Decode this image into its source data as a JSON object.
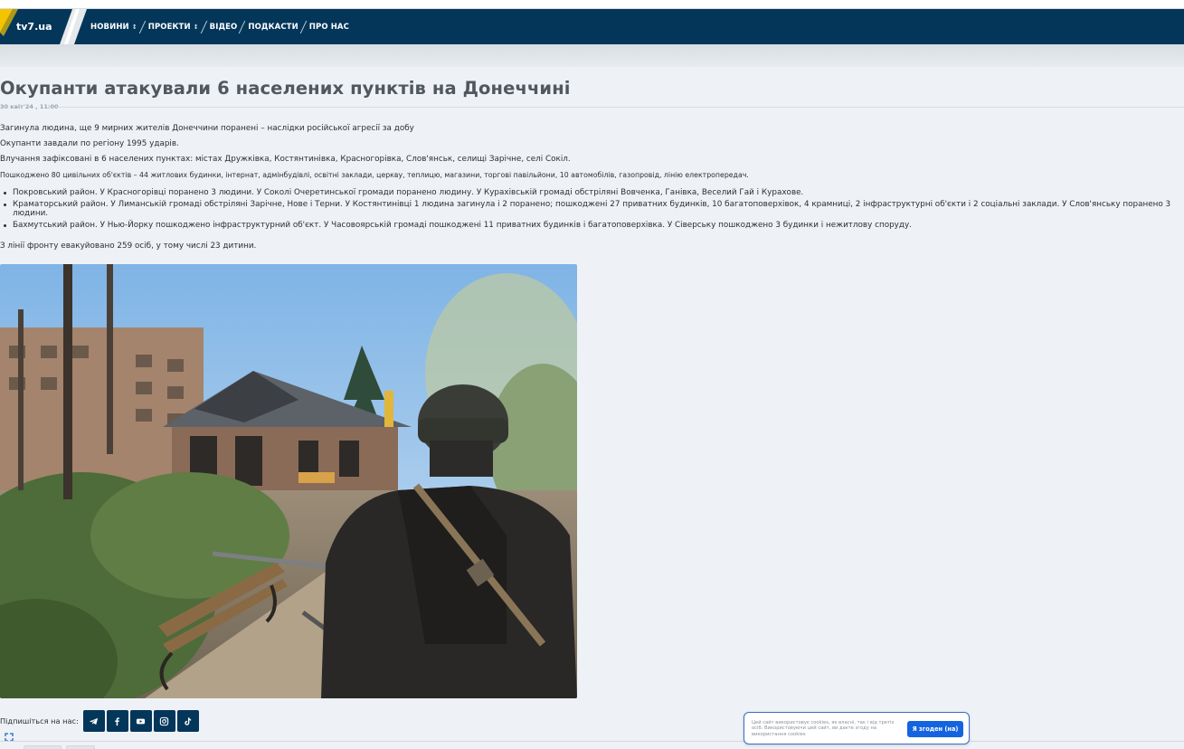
{
  "header": {
    "logo_text": "tv7.ua",
    "nav": [
      {
        "label": "НОВИНИ",
        "has_dropdown": true
      },
      {
        "label": "ПРОЕКТИ",
        "has_dropdown": true
      },
      {
        "label": "ВІДЕО",
        "has_dropdown": false
      },
      {
        "label": "ПОДКАСТИ",
        "has_dropdown": false
      },
      {
        "label": "ПРО НАС",
        "has_dropdown": false
      }
    ],
    "dropdown_icon": "caret-updown-icon",
    "colors": {
      "nav_bg": "#04365a",
      "logo_accent": "#f5c400"
    }
  },
  "article": {
    "title": "Окупанти атакували 6 населених пунктів на Донеччині",
    "date": "30 квіт'24 , 11:00",
    "paragraphs": [
      "Загинула людина, ще 9 мирних жителів Донеччини поранені – наслідки російської агресії за добу",
      "Окупанти завдали по регіону 1995 ударів.",
      "Влучання зафіксовані в 6 населених пунктах: містах Дружківка, Костянтинівка, Красногорівка, Слов'янськ, селищі Зарічне, селі Сокіл.",
      "Пошкоджено 80 цивільних об'єктів – 44 житлових будинки, інтернат, адмінбудівлі, освітні заклади, церкву, теплицю, магазини, торгові павільйони, 10 автомобілів, газопровід, лінію електропередач."
    ],
    "list": [
      "Покровський район. У Красногорівці поранено 3 людини. У Соколі Очеретинської громади поранено людину. У Курахівській громаді обстріляні Вовченка, Ганівка, Веселий Гай і Курахове.",
      "Краматорський район. У Лиманській громаді обстріляні Зарічне, Нове і Терни. У Костянтинівці 1 людина загинула і 2 поранено; пошкоджені 27 приватних будинків, 10 багатоповерхівок, 4 крамниці, 2 інфраструктурні об'єкти і 2 соціальні заклади. У Слов'янську поранено 3 людини.",
      "Бахмутський район. У Нью-Йорку пошкоджено інфраструктурний об'єкт. У Часовоярській громаді пошкоджені 11 приватних будинків і багатоповерхівка. У Сіверську пошкоджено 3 будинки і нежитлову споруду."
    ],
    "closing": "З лінії фронту евакуйовано 259 осіб, у тому числі 23 дитини."
  },
  "social": {
    "label": "Підпишіться на нас:",
    "buttons": [
      "telegram-icon",
      "facebook-icon",
      "youtube-icon",
      "instagram-icon",
      "tiktok-icon"
    ]
  },
  "cookie": {
    "text": "Цей сайт використовує cookies, як власні, так і від третіх осіб. Використовуючи цей сайт, ви даєте згоду на використання cookies",
    "button": "Я згоден (на)"
  }
}
